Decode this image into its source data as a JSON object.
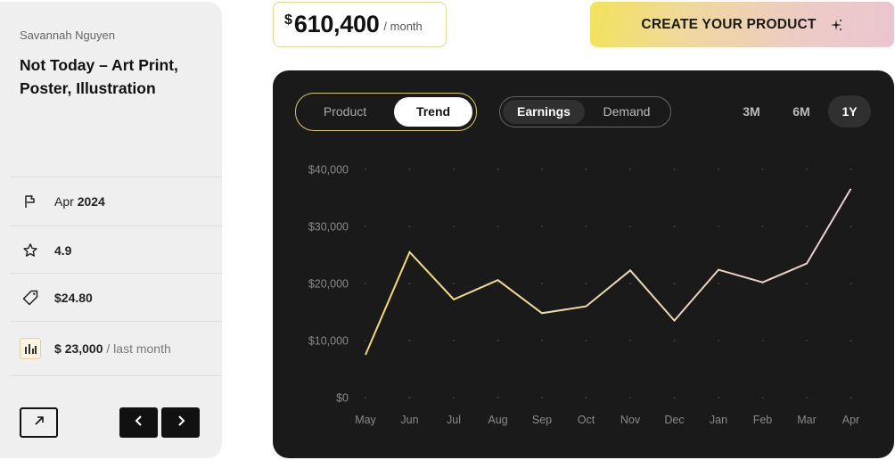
{
  "product": {
    "author": "Savannah Nguyen",
    "title": "Not Today – Art Print, Poster, Illustration",
    "date_month": "Apr",
    "date_year": "2024",
    "rating": "4.9",
    "price_currency": "$",
    "price_value": "24.80",
    "last_month_currency": "$",
    "last_month_value": "23,000",
    "last_month_suffix": "/ last month"
  },
  "header": {
    "price_currency": "$",
    "price_amount": "610,400",
    "price_period": "/ month",
    "create_label": "CREATE YOUR PRODUCT"
  },
  "tabs": {
    "view": [
      "Product",
      "Trend"
    ],
    "view_active": "Trend",
    "metric": [
      "Earnings",
      "Demand"
    ],
    "metric_active": "Earnings",
    "ranges": [
      "3M",
      "6M",
      "1Y"
    ],
    "range_active": "1Y"
  },
  "icons": {
    "date": "flag-icon",
    "rating": "star-icon",
    "price": "tag-icon",
    "earnings": "bar-chart-icon",
    "expand": "arrow-up-right-icon",
    "prev": "chevron-left-icon",
    "next": "chevron-right-icon",
    "create": "sparkle-icon"
  },
  "colors": {
    "accent_yellow": "#f5dc63",
    "accent_pink": "#ead0d6",
    "panel_bg": "#1a1a1a"
  },
  "chart_data": {
    "type": "line",
    "categories": [
      "May",
      "Jun",
      "Jul",
      "Aug",
      "Sep",
      "Oct",
      "Nov",
      "Dec",
      "Jan",
      "Feb",
      "Mar",
      "Apr"
    ],
    "series": [
      {
        "values": [
          7500,
          25500,
          17200,
          20600,
          14800,
          16000,
          22300,
          13500,
          22400,
          20200,
          23500,
          36600
        ]
      }
    ],
    "yticks": [
      "$0",
      "$10,000",
      "$20,000",
      "$30,000",
      "$40,000"
    ],
    "ylim": [
      0,
      40000
    ],
    "grid": "dotted",
    "line_gradient": [
      "#f5dc63",
      "#ead0d6"
    ]
  }
}
